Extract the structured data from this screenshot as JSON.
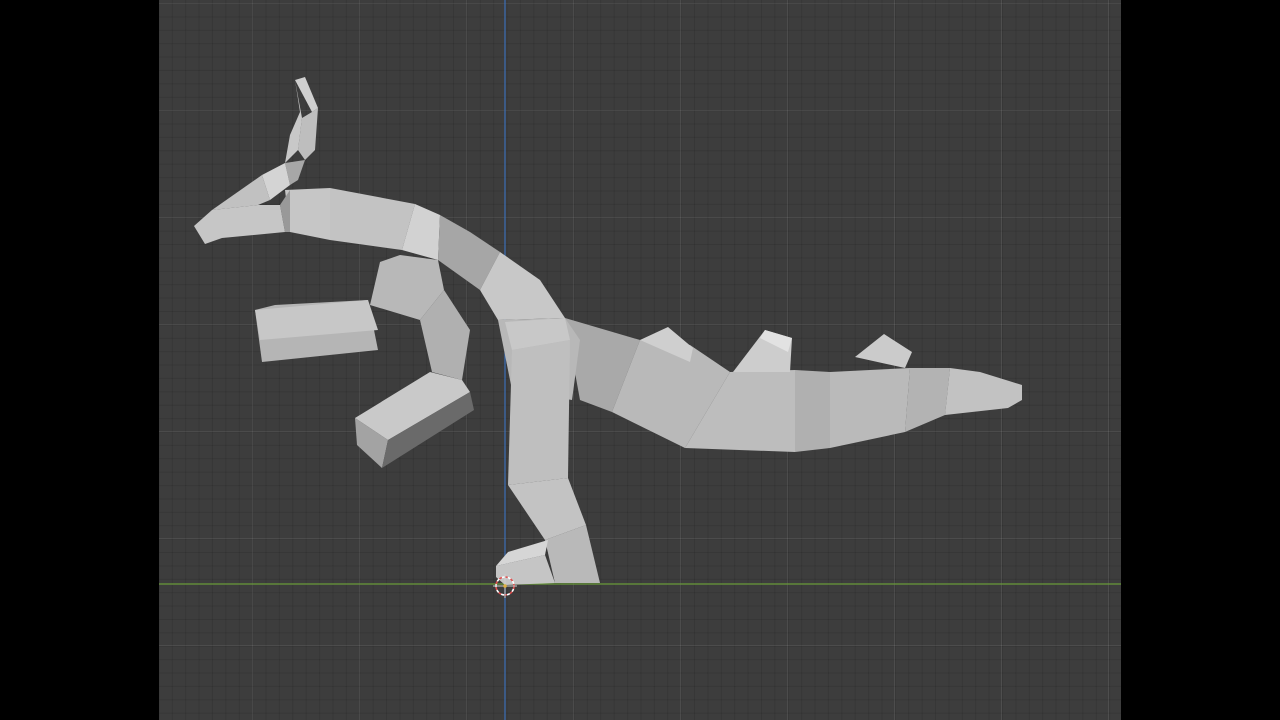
{
  "viewport": {
    "background": "#3d3d3d",
    "x_axis_color": "#6a9a3a",
    "z_axis_color": "#3b6fb6",
    "model_color": "#b4b4b4"
  },
  "objects": {
    "model": "dragon-mesh",
    "cursor": "3d-cursor-icon"
  }
}
